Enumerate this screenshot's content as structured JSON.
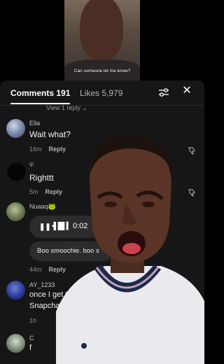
{
  "video": {
    "caption": "Can someone let me know?"
  },
  "header": {
    "comments_tab": "Comments 191",
    "likes_tab": "Likes 5,979"
  },
  "view_replies": "View 1 reply",
  "comments": [
    {
      "username": "Ella",
      "text": "Wait what?",
      "time": "16m",
      "reply_label": "Reply"
    },
    {
      "username": "ବ",
      "text": "Righttt",
      "time": "5m",
      "reply_label": "Reply"
    },
    {
      "username": "Nuaaq🐸",
      "voice_duration": "0:02",
      "text": "Boo smoochie. boo s",
      "time": "44m",
      "reply_label": "Reply"
    },
    {
      "username": "AY_1233",
      "text_line1": "once I get tha",
      "text_line2": "Snapchat",
      "time": "1h"
    },
    {
      "username": "C",
      "text": "f"
    }
  ],
  "colors": {
    "panel": "#161616",
    "accent": "#ffffff",
    "muted": "#8d8d8d"
  }
}
